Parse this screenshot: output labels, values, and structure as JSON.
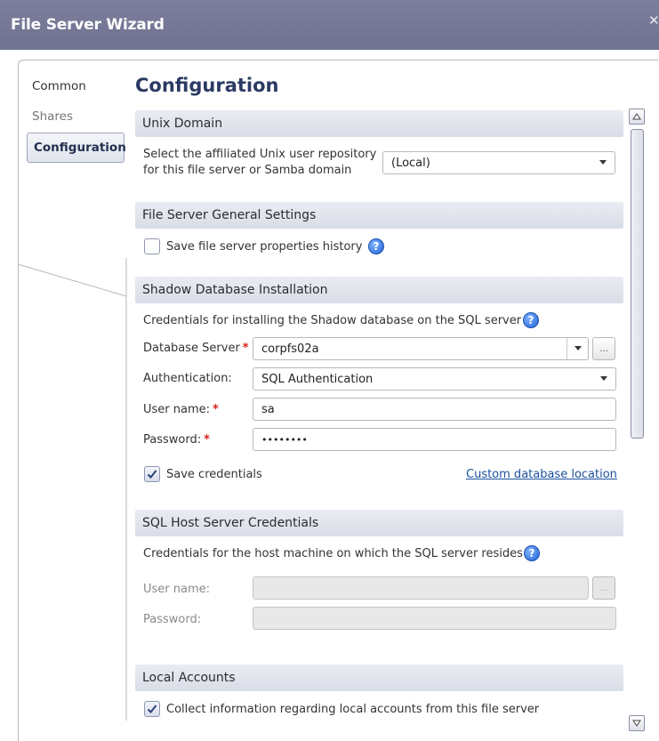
{
  "window": {
    "title": "File Server Wizard",
    "close_glyph": "✕"
  },
  "nav": {
    "items": [
      {
        "label": "Common"
      },
      {
        "label": "Shares"
      },
      {
        "label": "Configuration"
      }
    ],
    "selected": "Configuration"
  },
  "page": {
    "title": "Configuration"
  },
  "unix_domain": {
    "header": "Unix Domain",
    "prompt_line1": "Select the affiliated Unix user repository",
    "prompt_line2": "for this file server or Samba domain",
    "repository_value": "(Local)"
  },
  "general": {
    "header": "File Server General Settings",
    "save_history_label": "Save file server properties history",
    "save_history_checked": false
  },
  "shadow_db": {
    "header": "Shadow Database Installation",
    "description": "Credentials for installing the Shadow database on the SQL server",
    "db_server_label": "Database Server",
    "db_server_value": "corpfs02a",
    "auth_label": "Authentication:",
    "auth_value": "SQL Authentication",
    "user_label": "User name:",
    "user_value": "sa",
    "password_label": "Password:",
    "password_value": "••••••••",
    "save_credentials_label": "Save credentials",
    "save_credentials_checked": true,
    "custom_location_link": "Custom database location",
    "required_marker": "*",
    "browse_glyph": "..."
  },
  "sql_host": {
    "header": "SQL Host Server Credentials",
    "description": "Credentials for the host machine on which the SQL server resides",
    "user_label": "User name:",
    "password_label": "Password:",
    "browse_glyph": "..."
  },
  "local_accounts": {
    "header": "Local Accounts",
    "collect_label": "Collect information regarding local accounts from this file server",
    "collect_checked": true
  },
  "icons": {
    "help": "help-icon",
    "check": "check-icon",
    "dropdown": "chevron-down-icon",
    "scroll_up": "arrow-up-icon",
    "scroll_down": "arrow-down-icon"
  },
  "colors": {
    "titlebar": "#7c7f9c",
    "page_title": "#2b3a63",
    "link": "#1a4f9c",
    "required": "#d62020",
    "section_header": "#e2e6ee"
  }
}
